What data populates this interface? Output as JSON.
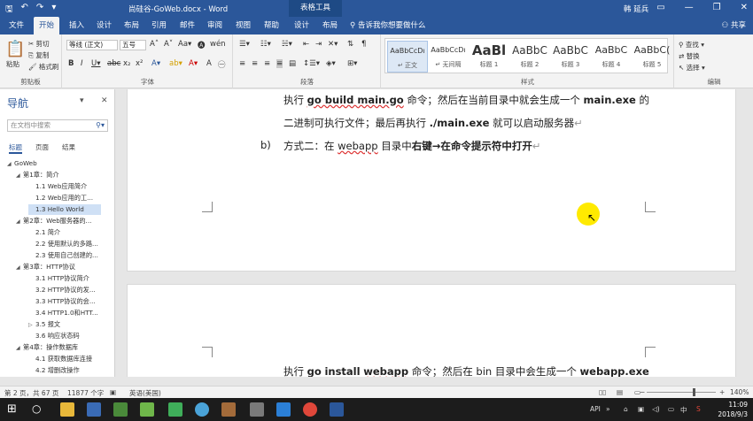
{
  "titlebar": {
    "doc_title": "尚硅谷-GoWeb.docx - Word",
    "context_tab_title": "表格工具",
    "user_name": "韩 延兵"
  },
  "tabs": [
    "文件",
    "开始",
    "插入",
    "设计",
    "布局",
    "引用",
    "邮件",
    "审阅",
    "视图",
    "帮助",
    "设计",
    "布局"
  ],
  "active_tab": "开始",
  "tellme_placeholder": "告诉我你想要做什么",
  "share_label": "共享",
  "ribbon": {
    "clipboard": {
      "label": "剪贴板",
      "paste": "粘贴",
      "cut": "剪切",
      "copy": "复制",
      "format_painter": "格式刷"
    },
    "font": {
      "label": "字体",
      "font_name": "等线 (正文)",
      "font_size": "五号"
    },
    "paragraph": {
      "label": "段落"
    },
    "styles": {
      "label": "样式",
      "items": [
        {
          "preview": "AaBbCcDı",
          "name": "↵ 正文"
        },
        {
          "preview": "AaBbCcDı",
          "name": "↵ 无间隔"
        },
        {
          "preview": "AaBl",
          "name": "标题 1"
        },
        {
          "preview": "AaBbC",
          "name": "标题 2"
        },
        {
          "preview": "AaBbC",
          "name": "标题 3"
        },
        {
          "preview": "AaBbC",
          "name": "标题 4"
        },
        {
          "preview": "AaBbC(",
          "name": "标题 5"
        }
      ]
    },
    "editing": {
      "label": "编辑",
      "find": "查找",
      "replace": "替换",
      "select": "选择"
    }
  },
  "nav": {
    "title": "导航",
    "search_placeholder": "在文档中搜索",
    "tabs": [
      "标题",
      "页面",
      "结果"
    ],
    "tree": [
      {
        "text": "GoWeb",
        "level": 0,
        "expanded": true
      },
      {
        "text": "第1章：简介",
        "level": 1,
        "expanded": true
      },
      {
        "text": "1.1 Web应用简介",
        "level": 2
      },
      {
        "text": "1.2 Web应用的工...",
        "level": 2
      },
      {
        "text": "1.3 Hello World",
        "level": 2,
        "selected": true
      },
      {
        "text": "第2章：Web服务器的...",
        "level": 1,
        "expanded": true
      },
      {
        "text": "2.1 简介",
        "level": 2
      },
      {
        "text": "2.2 使用默认的多路...",
        "level": 2
      },
      {
        "text": "2.3 使用自己创建的...",
        "level": 2
      },
      {
        "text": "第3章：HTTP协议",
        "level": 1,
        "expanded": true
      },
      {
        "text": "3.1 HTTP协议简介",
        "level": 2
      },
      {
        "text": "3.2 HTTP协议的发...",
        "level": 2
      },
      {
        "text": "3.3 HTTP协议的会...",
        "level": 2
      },
      {
        "text": "3.4 HTTP1.0和HTT...",
        "level": 2
      },
      {
        "text": "3.5 报文",
        "level": 2,
        "collapsed": true
      },
      {
        "text": "3.6 响应状态码",
        "level": 2
      },
      {
        "text": "第4章：操作数据库",
        "level": 1,
        "expanded": true
      },
      {
        "text": "4.1 获取数据库连接",
        "level": 2
      },
      {
        "text": "4.2 增删改操作",
        "level": 2
      }
    ]
  },
  "doc": {
    "line1": {
      "t1": "执行 ",
      "b1": "go build main.go",
      "t2": " 命令；然后在当前目录中就会生成一个 ",
      "b2": "main.exe",
      "t3": " 的"
    },
    "line2": {
      "t1": "二进制可执行文件；最后再执行 ",
      "b1": "./main.exe",
      "t2": " 就可以启动服务器"
    },
    "line3": {
      "marker": "b)",
      "t1": "方式二：在 ",
      "u1": "webapp",
      "t2": " 目录中",
      "b1": "右键→在命令提示符中打开"
    },
    "line4": {
      "t1": "执行 ",
      "b1": "go",
      "t2": " ",
      "b2": "install",
      "t3": " ",
      "bu1": "webapp",
      "t4": " 命令；然后在 bin 目录中会生成一个 ",
      "b3": "webapp.exe"
    }
  },
  "status": {
    "page": "第 2 页，共 67 页",
    "words": "11877 个字",
    "lang": "英语(美国)",
    "zoom": "140%"
  },
  "taskbar": {
    "tray_api": "API",
    "ime": "中",
    "time": "11:09",
    "date": "2018/9/3"
  }
}
